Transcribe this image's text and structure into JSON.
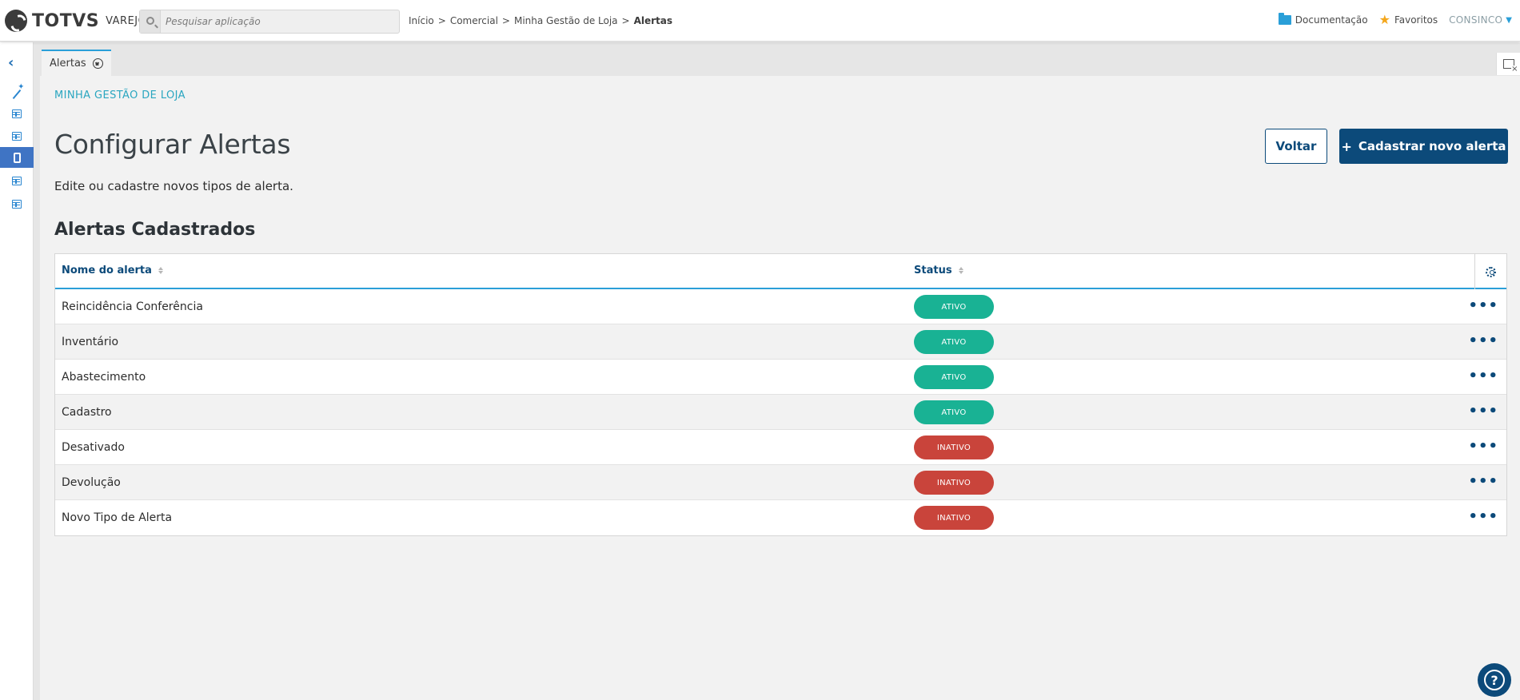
{
  "header": {
    "brand": "TOTVS",
    "brand_sub": "VAREJO",
    "search_placeholder": "Pesquisar aplicação",
    "breadcrumb": [
      "Início",
      "Comercial",
      "Minha Gestão de Loja",
      "Alertas"
    ],
    "documentation": "Documentação",
    "favorites": "Favoritos",
    "user": "CONSINCO"
  },
  "tabs": [
    {
      "label": "Alertas"
    }
  ],
  "page": {
    "section": "MINHA GESTÃO DE LOJA",
    "title": "Configurar Alertas",
    "description": "Edite ou cadastre novos tipos de alerta.",
    "back_label": "Voltar",
    "new_label": "Cadastrar novo alerta",
    "subtitle": "Alertas Cadastrados"
  },
  "table": {
    "columns": [
      "Nome do alerta",
      "Status"
    ],
    "rows": [
      {
        "name": "Reincidência Conferência",
        "status": "ATIVO"
      },
      {
        "name": "Inventário",
        "status": "ATIVO"
      },
      {
        "name": "Abastecimento",
        "status": "ATIVO"
      },
      {
        "name": "Cadastro",
        "status": "ATIVO"
      },
      {
        "name": "Desativado",
        "status": "INATIVO"
      },
      {
        "name": "Devolução",
        "status": "INATIVO"
      },
      {
        "name": "Novo Tipo de Alerta",
        "status": "INATIVO"
      }
    ]
  },
  "colors": {
    "primary": "#0c4a7a",
    "active": "#19b294",
    "inactive": "#c9443b",
    "accent": "#2a9fd8"
  }
}
